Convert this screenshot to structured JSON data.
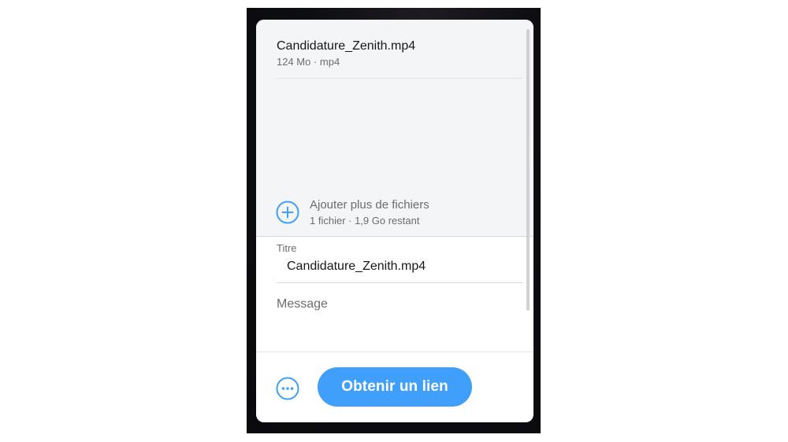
{
  "file": {
    "name": "Candidature_Zenith.mp4",
    "meta": "124 Mo · mp4"
  },
  "add_files": {
    "icon": "plus-circle-icon",
    "label": "Ajouter plus de fichiers",
    "meta": "1 fichier · 1,9 Go restant"
  },
  "form": {
    "title_label": "Titre",
    "title_value": "Candidature_Zenith.mp4",
    "message_placeholder": "Message"
  },
  "footer": {
    "more_icon": "more-options-icon",
    "primary_label": "Obtenir un lien"
  },
  "colors": {
    "accent": "#409ffa",
    "files_background": "#f4f5f7"
  }
}
